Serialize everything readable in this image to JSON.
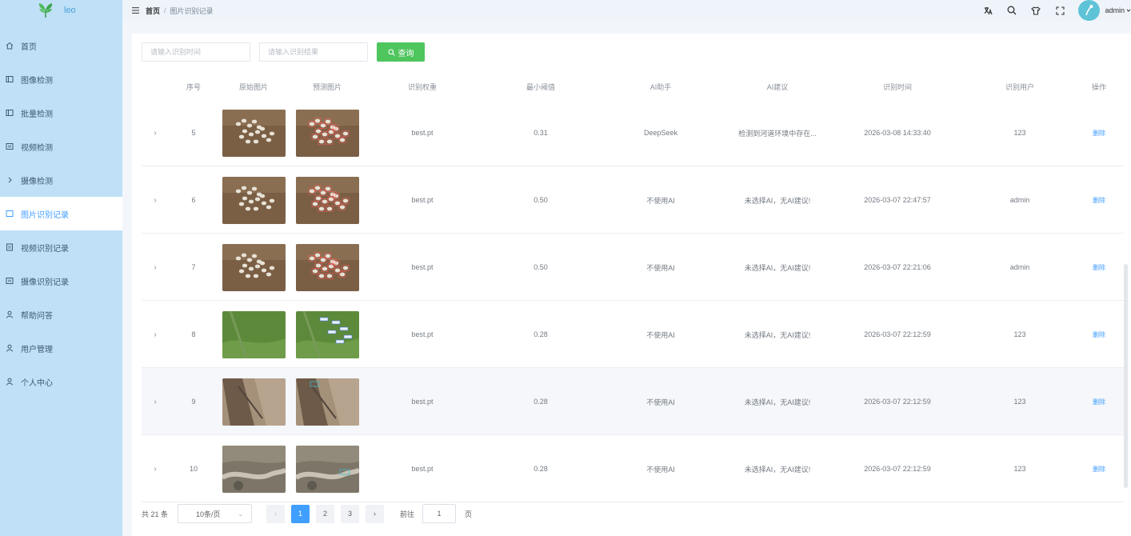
{
  "app": {
    "logo_text": "leo"
  },
  "sidebar": {
    "items": [
      {
        "label": "首页",
        "icon": "home-icon",
        "active": false
      },
      {
        "label": "图像检测",
        "icon": "image-icon",
        "active": false
      },
      {
        "label": "批量检测",
        "icon": "batch-icon",
        "active": false
      },
      {
        "label": "视频检测",
        "icon": "video-icon",
        "active": false
      },
      {
        "label": "摄像检测",
        "icon": "camera-icon",
        "active": false
      },
      {
        "label": "图片识别记录",
        "icon": "record-icon",
        "active": true
      },
      {
        "label": "视频识别记录",
        "icon": "video-record-icon",
        "active": false
      },
      {
        "label": "摄像识别记录",
        "icon": "camera-record-icon",
        "active": false
      },
      {
        "label": "帮助问答",
        "icon": "help-icon",
        "active": false
      },
      {
        "label": "用户管理",
        "icon": "users-icon",
        "active": false
      },
      {
        "label": "个人中心",
        "icon": "user-icon",
        "active": false
      }
    ]
  },
  "header": {
    "breadcrumb": {
      "home": "首页",
      "separator": "/",
      "current": "图片识别记录"
    },
    "username": "admin"
  },
  "search": {
    "time_placeholder": "请输入识别时间",
    "result_placeholder": "请输入识别结果",
    "button_label": "查询"
  },
  "table": {
    "columns": [
      "序号",
      "原始图片",
      "预测图片",
      "识别权重",
      "最小阈值",
      "AI助手",
      "AI建议",
      "识别时间",
      "识别用户",
      "操作"
    ],
    "delete_label": "删除",
    "rows": [
      {
        "id": "5",
        "weight": "best.pt",
        "conf": "0.31",
        "ai": "DeepSeek",
        "advice": "检测到河道环境中存在...",
        "time": "2026-03-08 14:33:40",
        "user": "123",
        "thumb": "sheep-icon"
      },
      {
        "id": "6",
        "weight": "best.pt",
        "conf": "0.50",
        "ai": "不使用AI",
        "advice": "未选择AI，无AI建议!",
        "time": "2026-03-07 22:47:57",
        "user": "admin",
        "thumb": "sheep-icon"
      },
      {
        "id": "7",
        "weight": "best.pt",
        "conf": "0.50",
        "ai": "不使用AI",
        "advice": "未选择AI，无AI建议!",
        "time": "2026-03-07 22:21:06",
        "user": "admin",
        "thumb": "sheep-icon"
      },
      {
        "id": "8",
        "weight": "best.pt",
        "conf": "0.28",
        "ai": "不使用AI",
        "advice": "未选择AI，无AI建议!",
        "time": "2026-03-07 22:12:59",
        "user": "123",
        "thumb": "field-icon"
      },
      {
        "id": "9",
        "weight": "best.pt",
        "conf": "0.28",
        "ai": "不使用AI",
        "advice": "未选择AI，无AI建议!",
        "time": "2026-03-07 22:12:59",
        "user": "123",
        "thumb": "rock-icon"
      },
      {
        "id": "10",
        "weight": "best.pt",
        "conf": "0.28",
        "ai": "不使用AI",
        "advice": "未选择AI，无AI建议!",
        "time": "2026-03-07 22:12:59",
        "user": "123",
        "thumb": "river-icon"
      }
    ]
  },
  "pagination": {
    "total": "共 21 条",
    "page_size": "10条/页",
    "pages": [
      "1",
      "2",
      "3"
    ],
    "current_page": "1",
    "goto_label": "前往",
    "goto_value": "1",
    "page_suffix": "页"
  },
  "colors": {
    "sidebar_bg": "#bfe0f6",
    "accent": "#409eff",
    "search_button": "#4fc55e"
  }
}
